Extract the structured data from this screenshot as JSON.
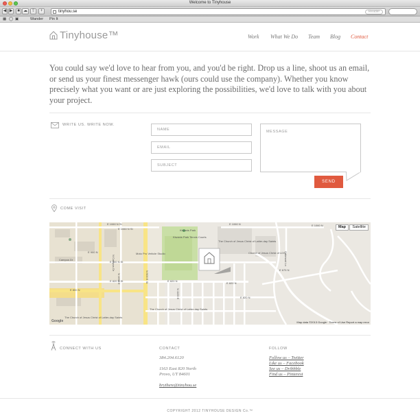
{
  "browser": {
    "window_title": "Welcome to Tinyhouse",
    "address": "tinyhou.se",
    "reader_label": "Reader",
    "bookmarks": [
      "Wander",
      "Pin It"
    ]
  },
  "site": {
    "logo_text": "Tinyhouse™",
    "nav": [
      "Work",
      "What We Do",
      "Team",
      "Blog",
      "Contact"
    ],
    "active_nav": "Contact"
  },
  "intro": "You could say we'd love to hear from you, and you'd be right. Drop us a line, shoot us an email, or send us your finest messenger hawk (ours could use the company). Whether you know precisely what you want or are just exploring the possibilities, we'd love to talk with you about your project.",
  "contact_form": {
    "section_label": "WRITE US. WRITE NOW.",
    "name_placeholder": "NAME",
    "email_placeholder": "EMAIL",
    "subject_placeholder": "SUBJECT",
    "message_placeholder": "MESSAGE",
    "send_label": "SEND"
  },
  "visit": {
    "section_label": "COME VISIT"
  },
  "map": {
    "map_button": "Map",
    "satellite_button": "Satellite",
    "attribution": "Map data ©2013 Google · Terms of Use   Report a map error",
    "logo": "Google",
    "labels": [
      "E 1060 N St",
      "E 1060 N St",
      "E 1060 N",
      "E 1060 N",
      "Kiwanis Park",
      "Kiwanis Park Tennis Courts",
      "The Church of Jesus Christ of Latter-day Saints",
      "N Campus Dr",
      "E 900 N",
      "E 900 N St",
      "Moto Pro Vehicle Studio",
      "Campus Dr",
      "E 820 N St",
      "E 820 N",
      "E 820 N",
      "E 800 N",
      "N 1000 E",
      "N 900 E St",
      "N 1100 E",
      "Church of Jesus Christ of LDS",
      "Oakmont Ln",
      "E 675 N",
      "The Church of Jesus Christ of Latter-day Saints",
      "The Church of Jesus Christ of Latter-day Saints",
      "E 820 N"
    ]
  },
  "footer": {
    "connect_label": "CONNECT WITH US",
    "contact_head": "CONTACT",
    "phone": "384.204.6120",
    "address_line1": "1163 East 820 North",
    "address_line2": "Provo, UT 84601",
    "email": "brythere@tinyhou.se",
    "follow_head": "FOLLOW",
    "follow_links": [
      "Follow us – Twitter",
      "Like us – Facebook",
      "See us – Dribbble",
      "Find us – Pinterest"
    ],
    "copyright": "COPYRIGHT 2012   TINYHOUSE DESIGN Co.™"
  },
  "colors": {
    "accent": "#e05a3f",
    "park": "#c9dfa6",
    "major_road": "#f8e486"
  }
}
